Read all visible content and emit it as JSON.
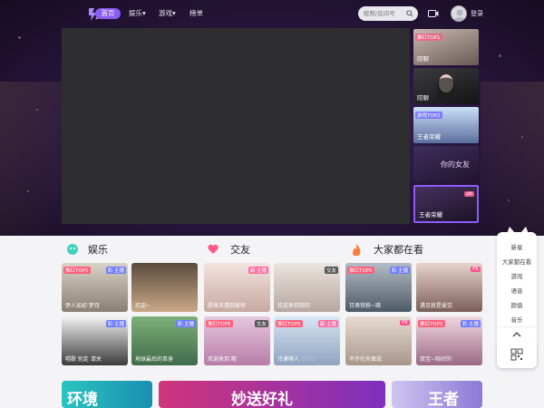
{
  "nav": {
    "home": "首页",
    "ent": "娱乐",
    "game": "游戏",
    "rank": "榜单",
    "search_placeholder": "昵称/房间号",
    "login": "登录"
  },
  "side_list": [
    {
      "tag": "推红TOP1",
      "name": "陪聊"
    },
    {
      "tag": "",
      "name": "陪聊"
    },
    {
      "tag": "游戏TOP2",
      "name": "王者荣耀"
    },
    {
      "tag": "",
      "name": "你的女友"
    },
    {
      "tag": "",
      "name": "王者荣耀"
    }
  ],
  "float_panel": [
    "新星",
    "大家都在看",
    "游戏",
    "语音",
    "颜值",
    "音乐"
  ],
  "sections": [
    {
      "title": "娱乐"
    },
    {
      "title": "交友"
    },
    {
      "title": "大家都在看"
    }
  ],
  "cards_row1": [
    {
      "cap": "伊人如初 梦月",
      "tag_l": "推红TOP5",
      "tag_r": "彩·主播"
    },
    {
      "cap": "欢迎~",
      "tag_l": "",
      "tag_r": ""
    },
    {
      "cap": "愿每天遇到爱你",
      "tag_l": "",
      "tag_r": "甜·主播"
    },
    {
      "cap": "欢迎来到我的",
      "tag_l": "",
      "tag_r": "交友"
    },
    {
      "cap": "甘肃铁粉~暗",
      "tag_l": "推红TOP5",
      "tag_r": "彩·主播"
    },
    {
      "cap": "遇见就是爱交",
      "tag_l": "",
      "tag_r": "PK"
    }
  ],
  "cards_row2": [
    {
      "cap": "唱歌 别走 请关",
      "tag_l": "",
      "tag_r": "彩·主播"
    },
    {
      "cap": "地球最后的单身",
      "tag_l": "",
      "tag_r": "彩·主播"
    },
    {
      "cap": "欢迎来到 期",
      "tag_l": "推红TOP5",
      "tag_r": "交友"
    },
    {
      "cap": "冷漠萌人 ♡♡♡",
      "tag_l": "推红TOP5",
      "tag_r": "甜·主播"
    },
    {
      "cap": "不许在外面说",
      "tag_l": "",
      "tag_r": "PK"
    },
    {
      "cap": "双宝~陪好的",
      "tag_l": "推红TOP5",
      "tag_r": "彩·主播"
    }
  ],
  "banners": [
    "环境",
    "妙送好礼",
    "王者"
  ],
  "colors": {
    "accent": "#8b5cf6",
    "hot": "#ff5f7a"
  }
}
